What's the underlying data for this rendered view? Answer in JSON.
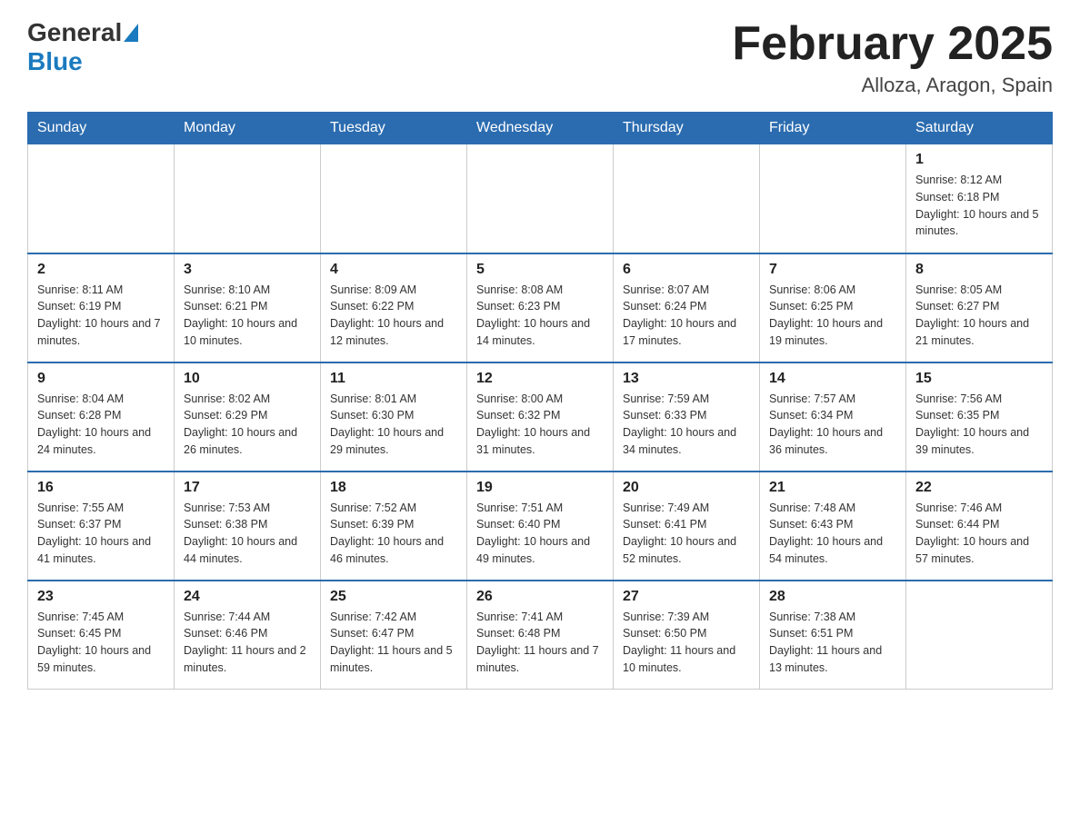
{
  "header": {
    "logo": {
      "general": "General",
      "blue": "Blue"
    },
    "title": "February 2025",
    "subtitle": "Alloza, Aragon, Spain"
  },
  "weekdays": [
    "Sunday",
    "Monday",
    "Tuesday",
    "Wednesday",
    "Thursday",
    "Friday",
    "Saturday"
  ],
  "weeks": [
    [
      {
        "day": "",
        "info": ""
      },
      {
        "day": "",
        "info": ""
      },
      {
        "day": "",
        "info": ""
      },
      {
        "day": "",
        "info": ""
      },
      {
        "day": "",
        "info": ""
      },
      {
        "day": "",
        "info": ""
      },
      {
        "day": "1",
        "info": "Sunrise: 8:12 AM\nSunset: 6:18 PM\nDaylight: 10 hours and 5 minutes."
      }
    ],
    [
      {
        "day": "2",
        "info": "Sunrise: 8:11 AM\nSunset: 6:19 PM\nDaylight: 10 hours and 7 minutes."
      },
      {
        "day": "3",
        "info": "Sunrise: 8:10 AM\nSunset: 6:21 PM\nDaylight: 10 hours and 10 minutes."
      },
      {
        "day": "4",
        "info": "Sunrise: 8:09 AM\nSunset: 6:22 PM\nDaylight: 10 hours and 12 minutes."
      },
      {
        "day": "5",
        "info": "Sunrise: 8:08 AM\nSunset: 6:23 PM\nDaylight: 10 hours and 14 minutes."
      },
      {
        "day": "6",
        "info": "Sunrise: 8:07 AM\nSunset: 6:24 PM\nDaylight: 10 hours and 17 minutes."
      },
      {
        "day": "7",
        "info": "Sunrise: 8:06 AM\nSunset: 6:25 PM\nDaylight: 10 hours and 19 minutes."
      },
      {
        "day": "8",
        "info": "Sunrise: 8:05 AM\nSunset: 6:27 PM\nDaylight: 10 hours and 21 minutes."
      }
    ],
    [
      {
        "day": "9",
        "info": "Sunrise: 8:04 AM\nSunset: 6:28 PM\nDaylight: 10 hours and 24 minutes."
      },
      {
        "day": "10",
        "info": "Sunrise: 8:02 AM\nSunset: 6:29 PM\nDaylight: 10 hours and 26 minutes."
      },
      {
        "day": "11",
        "info": "Sunrise: 8:01 AM\nSunset: 6:30 PM\nDaylight: 10 hours and 29 minutes."
      },
      {
        "day": "12",
        "info": "Sunrise: 8:00 AM\nSunset: 6:32 PM\nDaylight: 10 hours and 31 minutes."
      },
      {
        "day": "13",
        "info": "Sunrise: 7:59 AM\nSunset: 6:33 PM\nDaylight: 10 hours and 34 minutes."
      },
      {
        "day": "14",
        "info": "Sunrise: 7:57 AM\nSunset: 6:34 PM\nDaylight: 10 hours and 36 minutes."
      },
      {
        "day": "15",
        "info": "Sunrise: 7:56 AM\nSunset: 6:35 PM\nDaylight: 10 hours and 39 minutes."
      }
    ],
    [
      {
        "day": "16",
        "info": "Sunrise: 7:55 AM\nSunset: 6:37 PM\nDaylight: 10 hours and 41 minutes."
      },
      {
        "day": "17",
        "info": "Sunrise: 7:53 AM\nSunset: 6:38 PM\nDaylight: 10 hours and 44 minutes."
      },
      {
        "day": "18",
        "info": "Sunrise: 7:52 AM\nSunset: 6:39 PM\nDaylight: 10 hours and 46 minutes."
      },
      {
        "day": "19",
        "info": "Sunrise: 7:51 AM\nSunset: 6:40 PM\nDaylight: 10 hours and 49 minutes."
      },
      {
        "day": "20",
        "info": "Sunrise: 7:49 AM\nSunset: 6:41 PM\nDaylight: 10 hours and 52 minutes."
      },
      {
        "day": "21",
        "info": "Sunrise: 7:48 AM\nSunset: 6:43 PM\nDaylight: 10 hours and 54 minutes."
      },
      {
        "day": "22",
        "info": "Sunrise: 7:46 AM\nSunset: 6:44 PM\nDaylight: 10 hours and 57 minutes."
      }
    ],
    [
      {
        "day": "23",
        "info": "Sunrise: 7:45 AM\nSunset: 6:45 PM\nDaylight: 10 hours and 59 minutes."
      },
      {
        "day": "24",
        "info": "Sunrise: 7:44 AM\nSunset: 6:46 PM\nDaylight: 11 hours and 2 minutes."
      },
      {
        "day": "25",
        "info": "Sunrise: 7:42 AM\nSunset: 6:47 PM\nDaylight: 11 hours and 5 minutes."
      },
      {
        "day": "26",
        "info": "Sunrise: 7:41 AM\nSunset: 6:48 PM\nDaylight: 11 hours and 7 minutes."
      },
      {
        "day": "27",
        "info": "Sunrise: 7:39 AM\nSunset: 6:50 PM\nDaylight: 11 hours and 10 minutes."
      },
      {
        "day": "28",
        "info": "Sunrise: 7:38 AM\nSunset: 6:51 PM\nDaylight: 11 hours and 13 minutes."
      },
      {
        "day": "",
        "info": ""
      }
    ]
  ]
}
